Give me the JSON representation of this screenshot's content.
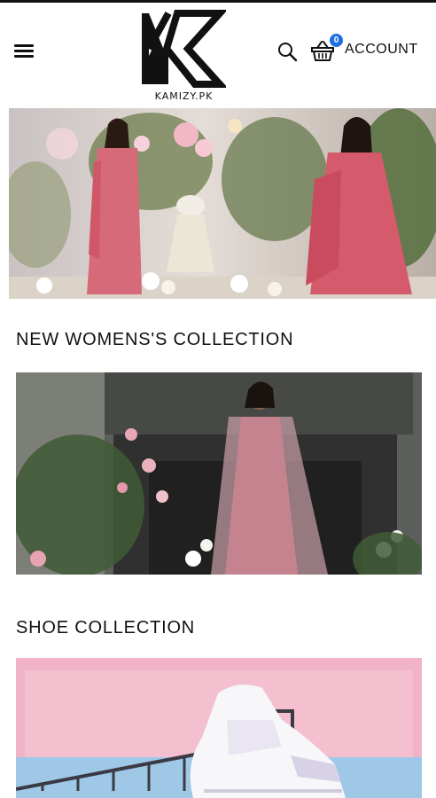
{
  "header": {
    "brand": "KAMIZY.PK",
    "cart_count": "0",
    "account_label": "ACCOUNT",
    "icons": [
      "hamburger-menu-icon",
      "search-icon",
      "shopping-basket-icon"
    ]
  },
  "sections": [
    {
      "title": "NEW WOMENS'S COLLECTION"
    },
    {
      "title": "SHOE COLLECTION"
    }
  ],
  "colors": {
    "text": "#111111",
    "badge": "#1d6fe0",
    "background": "#ffffff"
  }
}
